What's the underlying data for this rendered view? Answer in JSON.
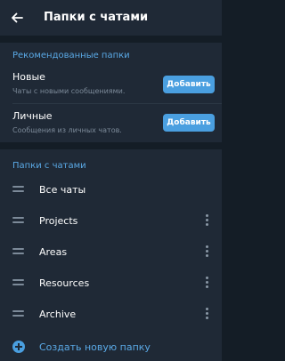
{
  "header": {
    "title": "Папки с чатами",
    "back_icon": "arrow-left-icon"
  },
  "recommended": {
    "section_title": "Рекомендованные папки",
    "items": [
      {
        "name": "Новые",
        "description": "Чаты с новыми сообщениями.",
        "button": "Добавить"
      },
      {
        "name": "Личные",
        "description": "Сообщения из личных чатов.",
        "button": "Добавить"
      }
    ]
  },
  "folders": {
    "section_title": "Папки с чатами",
    "items": [
      {
        "label": "Все чаты",
        "has_menu": false
      },
      {
        "label": "Projects",
        "has_menu": true
      },
      {
        "label": "Areas",
        "has_menu": true
      },
      {
        "label": "Resources",
        "has_menu": true
      },
      {
        "label": "Archive",
        "has_menu": true
      }
    ],
    "create_label": "Создать новую папку"
  },
  "colors": {
    "accent": "#4a9fe0",
    "background": "#141d26",
    "card": "#1f2936",
    "secondary_text": "#7c8a99"
  }
}
